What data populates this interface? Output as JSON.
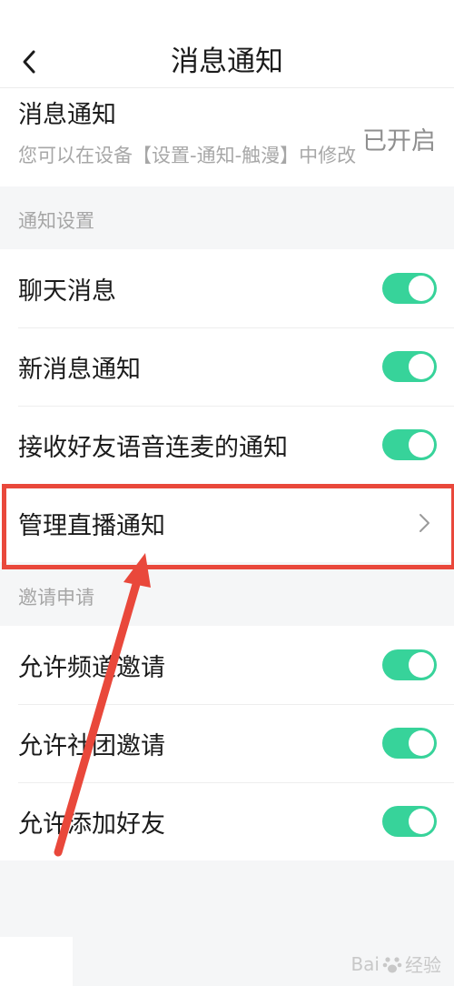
{
  "header": {
    "title": "消息通知"
  },
  "notice": {
    "title": "消息通知",
    "subtitle": "您可以在设备【设置-通知-触漫】中修改",
    "status": "已开启"
  },
  "sections": {
    "notify_settings": {
      "label": "通知设置",
      "items": [
        {
          "label": "聊天消息",
          "enabled": true
        },
        {
          "label": "新消息通知",
          "enabled": true
        },
        {
          "label": "接收好友语音连麦的通知",
          "enabled": true
        },
        {
          "label": "管理直播通知"
        }
      ]
    },
    "invites": {
      "label": "邀请申请",
      "items": [
        {
          "label": "允许频道邀请",
          "enabled": true
        },
        {
          "label": "允许社团邀请",
          "enabled": true
        },
        {
          "label": "允许添加好友",
          "enabled": true
        }
      ]
    }
  },
  "watermark": {
    "text_left": "Bai",
    "text_right": "经验"
  },
  "colors": {
    "toggle_on": "#37d39a",
    "annotation": "#e9483b"
  }
}
